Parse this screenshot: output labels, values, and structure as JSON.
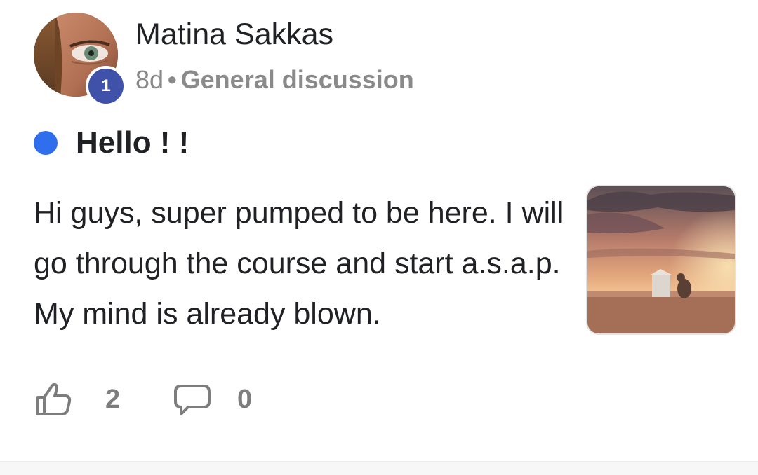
{
  "post": {
    "author": {
      "name": "Matina Sakkas",
      "level": "1"
    },
    "meta": {
      "time_ago": "8d",
      "separator": "•",
      "category": "General discussion"
    },
    "unread": true,
    "title": "Hello ! !",
    "body": "Hi guys, super pumped to be here. I will go through the course and start a.s.a.p. My mind is already blown.",
    "actions": {
      "likes": "2",
      "comments": "0"
    },
    "icons": {
      "like": "thumbs-up-icon",
      "comment": "comment-bubble-icon"
    }
  },
  "colors": {
    "level_badge": "#3f51a8",
    "unread_dot": "#2f6fed",
    "muted_text": "#8a8a8a"
  }
}
